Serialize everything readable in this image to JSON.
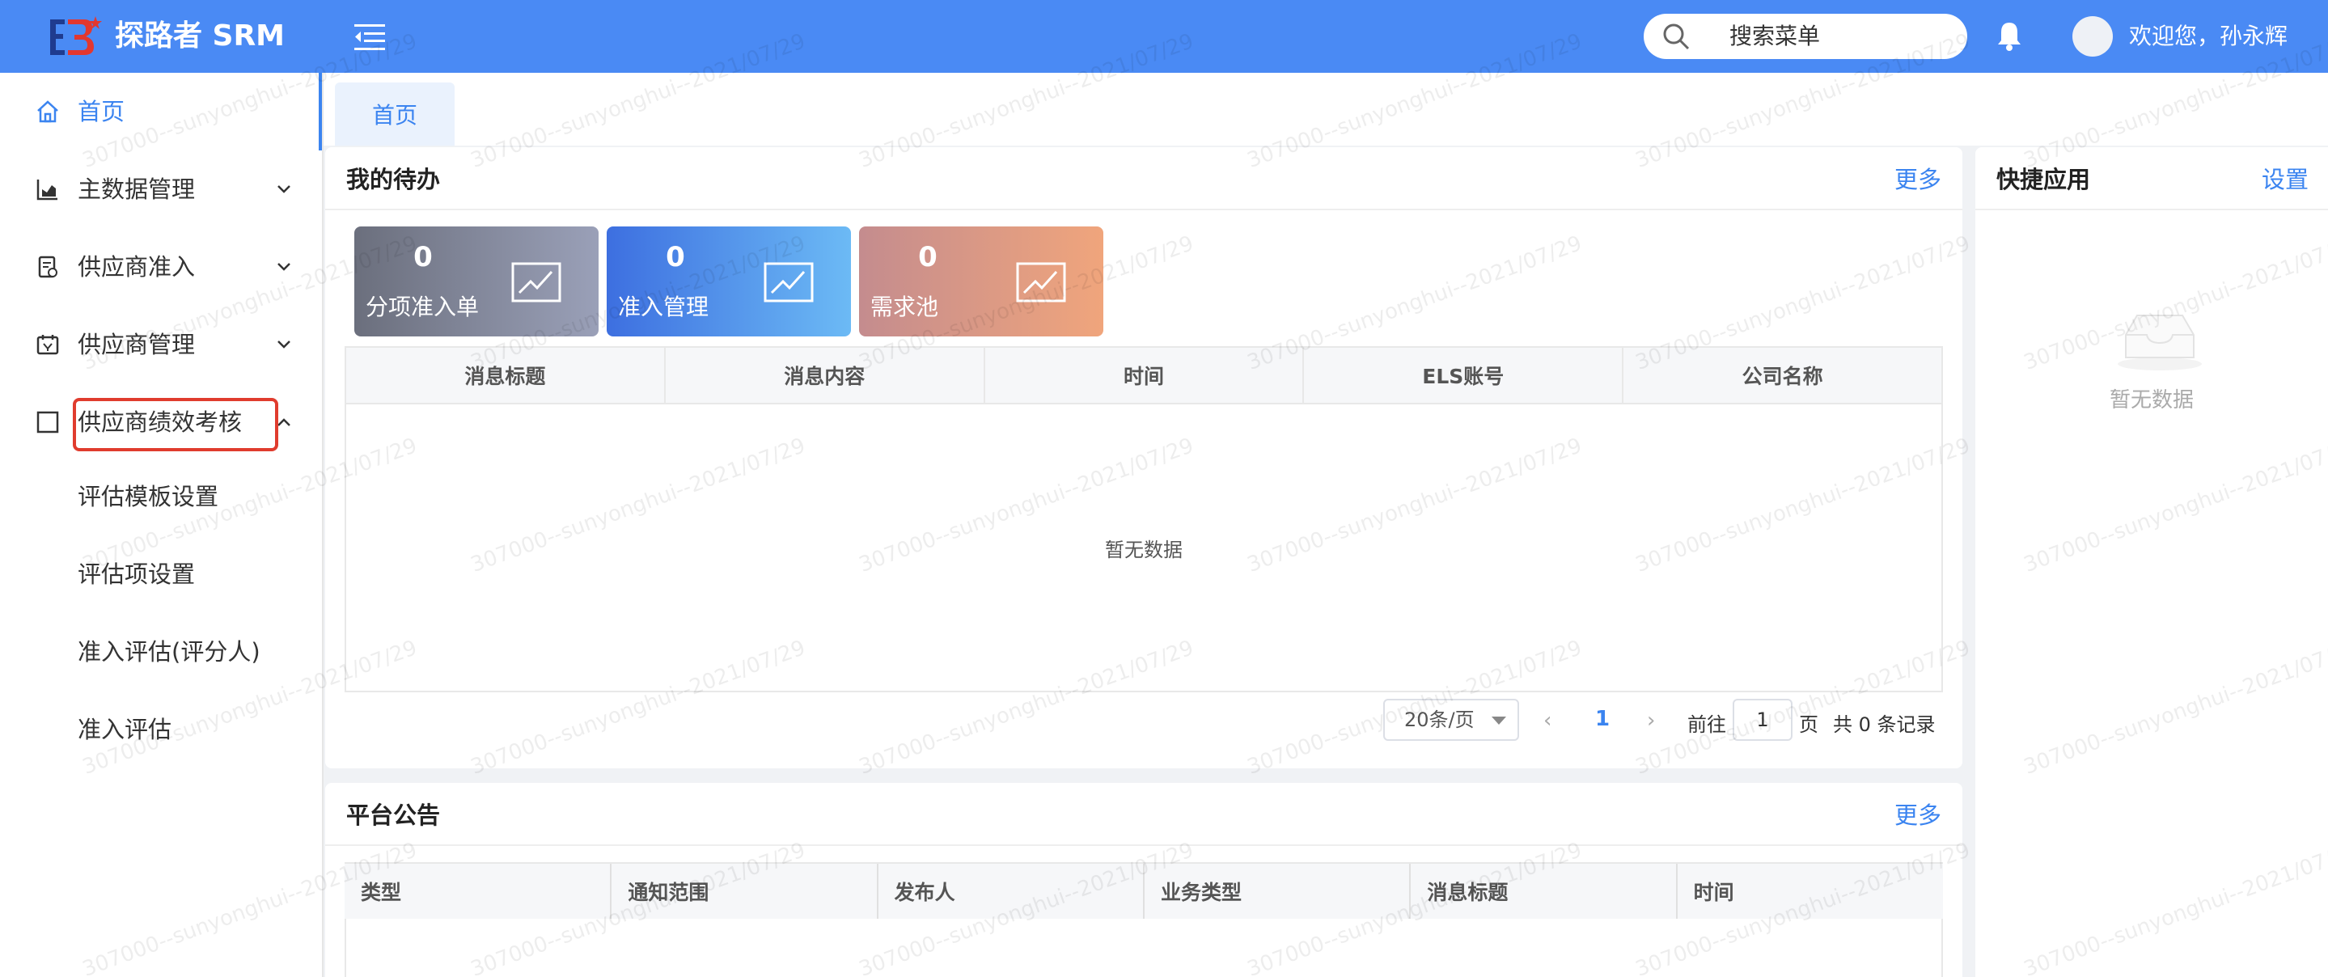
{
  "header": {
    "app_title": "探路者 SRM",
    "search_placeholder": "搜索菜单",
    "welcome": "欢迎您，孙永辉"
  },
  "sidebar": {
    "items": [
      {
        "label": "首页",
        "icon": "home-icon",
        "active": true
      },
      {
        "label": "主数据管理",
        "icon": "chart-icon"
      },
      {
        "label": "供应商准入",
        "icon": "document-icon"
      },
      {
        "label": "供应商管理",
        "icon": "calendar-icon"
      },
      {
        "label": "供应商绩效考核",
        "icon": "square-icon",
        "expanded": true
      }
    ],
    "sub_items": [
      {
        "label": "评估模板设置"
      },
      {
        "label": "评估项设置"
      },
      {
        "label": "准入评估(评分人)"
      },
      {
        "label": "准入评估"
      }
    ]
  },
  "tabs": [
    {
      "label": "首页"
    }
  ],
  "todo": {
    "title": "我的待办",
    "more": "更多",
    "stats": [
      {
        "value": "0",
        "label": "分项准入单"
      },
      {
        "value": "0",
        "label": "准入管理"
      },
      {
        "value": "0",
        "label": "需求池"
      }
    ],
    "columns": [
      "消息标题",
      "消息内容",
      "时间",
      "ELS账号",
      "公司名称"
    ],
    "empty": "暂无数据",
    "pager": {
      "page_size": "20条/页",
      "current_page": "1",
      "goto_label": "前往",
      "goto_value": "1",
      "page_unit": "页",
      "total": "共 0 条记录"
    }
  },
  "notice": {
    "title": "平台公告",
    "more": "更多",
    "columns": [
      "类型",
      "通知范围",
      "发布人",
      "业务类型",
      "消息标题",
      "时间"
    ]
  },
  "quick": {
    "title": "快捷应用",
    "settings": "设置",
    "empty": "暂无数据"
  },
  "watermark": "307000--sunyonghui--2021/07/29",
  "colors": {
    "header": "#4a8af4",
    "accent": "#3b84f0",
    "highlight": "#e03c2e"
  }
}
